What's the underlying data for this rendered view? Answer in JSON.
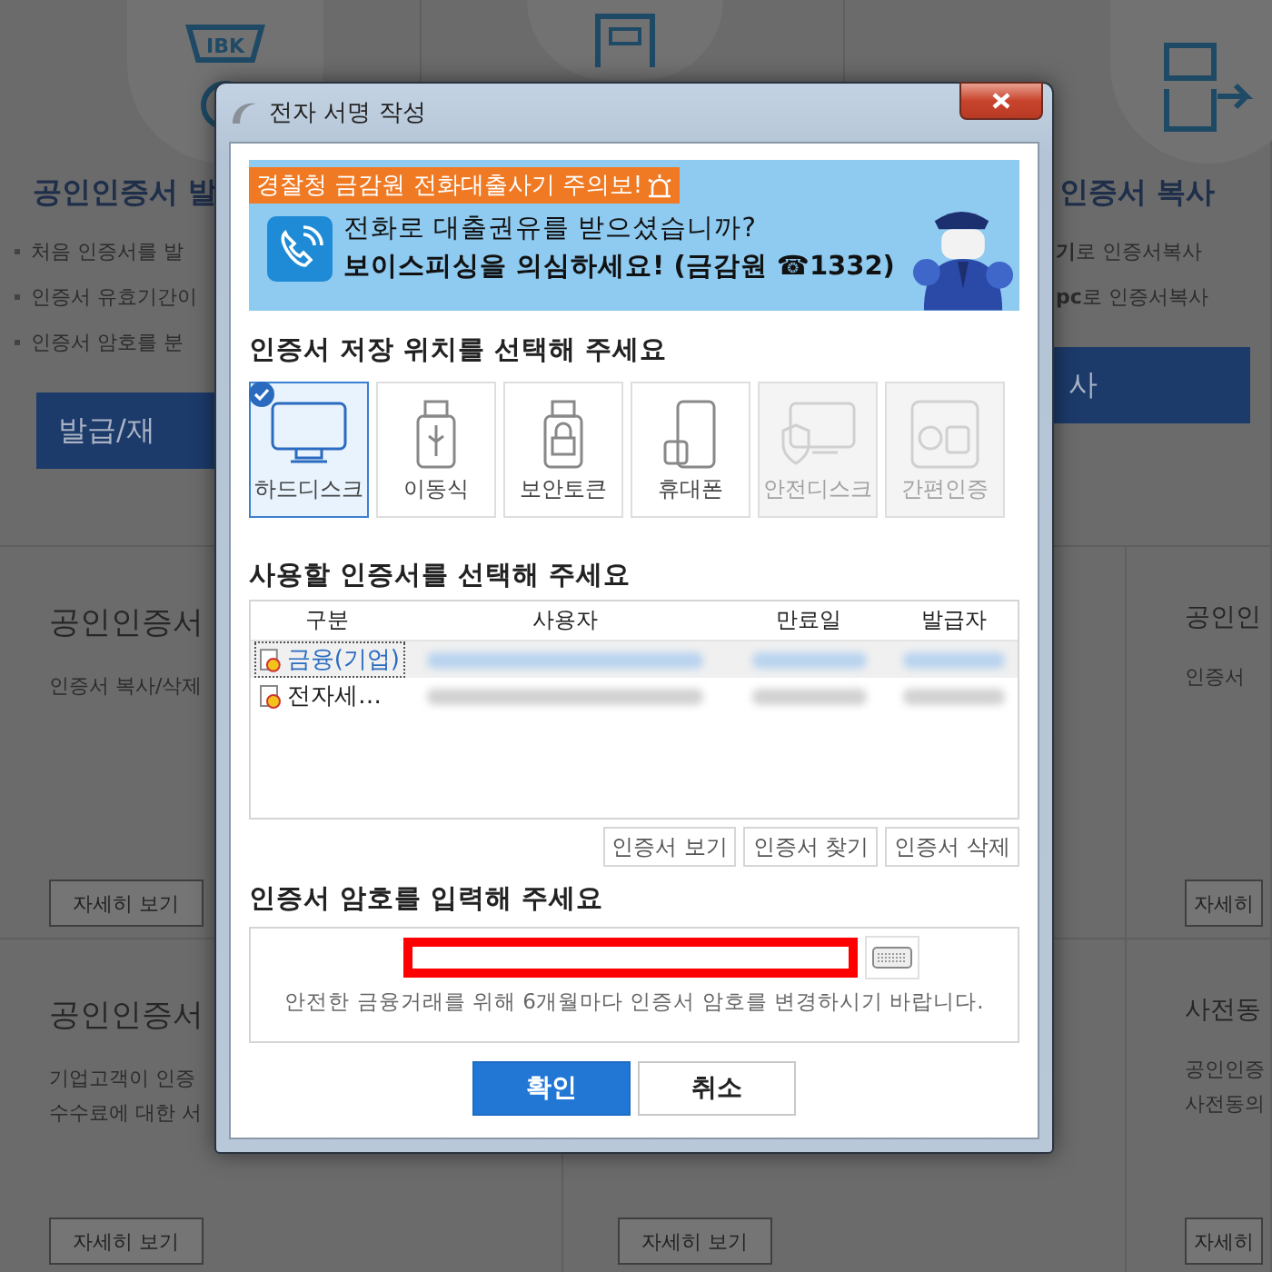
{
  "background": {
    "top_cards": [
      {
        "kind": "badge",
        "icon_text": "IBK",
        "title": "공인인증서 발",
        "bullets": [
          "처음 인증서를 발",
          "인증서 유효기간이",
          "인증서 암호를 분"
        ],
        "button": "발급/재"
      },
      {
        "kind": "document"
      },
      {
        "kind": "transfer",
        "title": "인증서 복사",
        "bullets": [
          "**기**로 인증서복사",
          "**pc**로 인증서복사"
        ],
        "button": "사"
      }
    ],
    "detail_rows": [
      [
        {
          "kind": "left",
          "title": "공인인증서",
          "lines": [
            "인증서 복사/삭제"
          ],
          "button": "자세히 보기"
        },
        {
          "kind": "right",
          "title": "공인인",
          "lines": [
            "인증서"
          ],
          "button": "자세히"
        }
      ],
      [
        {
          "kind": "left",
          "title": "공인인증서",
          "lines": [
            "기업고객이 인증",
            "수수료에 대한 서"
          ],
          "button": "자세히 보기"
        },
        {
          "kind": "middle",
          "button": "자세히 보기"
        },
        {
          "kind": "right",
          "title": "사전동",
          "lines": [
            "공인인증",
            "사전동의"
          ],
          "button": "자세히"
        }
      ]
    ]
  },
  "dialog": {
    "title": "전자 서명 작성",
    "banner": {
      "tag": "경찰청 금감원 전화대출사기 주의보!",
      "line1": "전화로 대출권유를 받으셨습니까?",
      "line2": "보이스피싱을 의심하세요! (금감원 ☎1332)"
    },
    "storage_heading": "인증서 저장 위치를 선택해 주세요",
    "storage": [
      {
        "label": "하드디스크",
        "selected": true,
        "disabled": false
      },
      {
        "label": "이동식",
        "selected": false,
        "disabled": false
      },
      {
        "label": "보안토큰",
        "selected": false,
        "disabled": false
      },
      {
        "label": "휴대폰",
        "selected": false,
        "disabled": false
      },
      {
        "label": "안전디스크",
        "selected": false,
        "disabled": true
      },
      {
        "label": "간편인증",
        "selected": false,
        "disabled": true
      }
    ],
    "cert_heading": "사용할 인증서를 선택해 주세요",
    "columns": [
      "구분",
      "사용자",
      "만료일",
      "발급자"
    ],
    "rows": [
      {
        "type": "금융(기업)",
        "selected": true
      },
      {
        "type": "전자세…",
        "selected": false
      }
    ],
    "cert_buttons": [
      "인증서 보기",
      "인증서 찾기",
      "인증서 삭제"
    ],
    "password_heading": "인증서 암호를 입력해 주세요",
    "password": {
      "highlighted": true
    },
    "password_note": "안전한 금융거래를 위해 6개월마다 인증서 암호를 변경하시기 바랍니다.",
    "buttons": [
      {
        "label": "확인",
        "kind": "primary"
      },
      {
        "label": "취소",
        "kind": "secondary"
      }
    ]
  }
}
